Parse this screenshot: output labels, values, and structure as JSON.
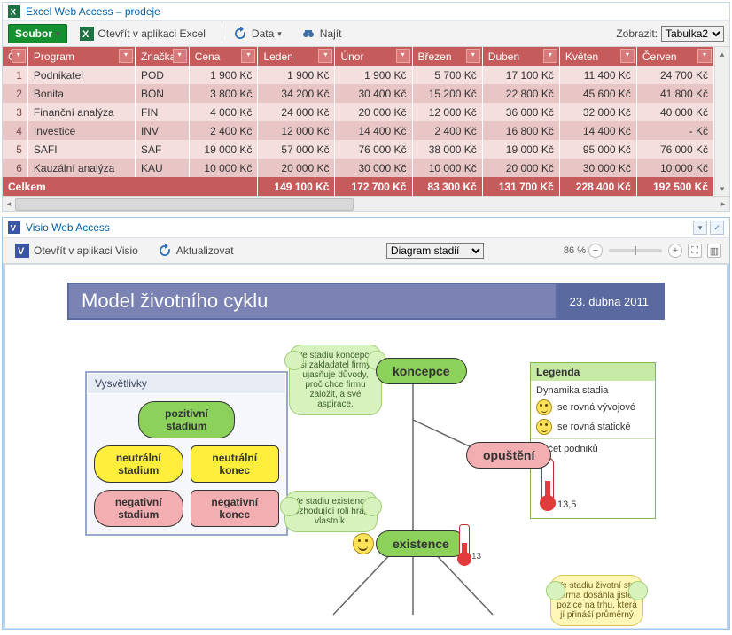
{
  "excel": {
    "title": "Excel Web Access – prodeje",
    "file_menu": "Soubor",
    "open_label": "Otevřít v aplikaci Excel",
    "data_label": "Data",
    "find_label": "Najít",
    "view_label": "Zobrazit:",
    "view_value": "Tabulka2",
    "columns": [
      "Č.",
      "Program",
      "Značka",
      "Cena",
      "Leden",
      "Únor",
      "Březen",
      "Duben",
      "Květen",
      "Červen"
    ],
    "rows": [
      {
        "n": "1",
        "prog": "Podnikatel",
        "zn": "POD",
        "cena": "1 900 Kč",
        "m": [
          "1 900 Kč",
          "1 900 Kč",
          "5 700 Kč",
          "17 100 Kč",
          "11 400 Kč",
          "24 700 Kč"
        ]
      },
      {
        "n": "2",
        "prog": "Bonita",
        "zn": "BON",
        "cena": "3 800 Kč",
        "m": [
          "34 200 Kč",
          "30 400 Kč",
          "15 200 Kč",
          "22 800 Kč",
          "45 600 Kč",
          "41 800 Kč"
        ]
      },
      {
        "n": "3",
        "prog": "Finanční analýza",
        "zn": "FIN",
        "cena": "4 000 Kč",
        "m": [
          "24 000 Kč",
          "20 000 Kč",
          "12 000 Kč",
          "36 000 Kč",
          "32 000 Kč",
          "40 000 Kč"
        ]
      },
      {
        "n": "4",
        "prog": "Investice",
        "zn": "INV",
        "cena": "2 400 Kč",
        "m": [
          "12 000 Kč",
          "14 400 Kč",
          "2 400 Kč",
          "16 800 Kč",
          "14 400 Kč",
          "-   Kč"
        ]
      },
      {
        "n": "5",
        "prog": "SAFI",
        "zn": "SAF",
        "cena": "19 000 Kč",
        "m": [
          "57 000 Kč",
          "76 000 Kč",
          "38 000 Kč",
          "19 000 Kč",
          "95 000 Kč",
          "76 000 Kč"
        ]
      },
      {
        "n": "6",
        "prog": "Kauzální analýza",
        "zn": "KAU",
        "cena": "10 000 Kč",
        "m": [
          "20 000 Kč",
          "30 000 Kč",
          "10 000 Kč",
          "20 000 Kč",
          "30 000 Kč",
          "10 000 Kč"
        ]
      }
    ],
    "total_label": "Celkem",
    "totals": [
      "149 100 Kč",
      "172 700 Kč",
      "83 300 Kč",
      "131 700 Kč",
      "228 400 Kč",
      "192 500 Kč"
    ]
  },
  "visio": {
    "title": "Visio Web Access",
    "open_label": "Otevřít v aplikaci Visio",
    "refresh_label": "Aktualizovat",
    "page_select": "Diagram stadií",
    "zoom": "86 %",
    "diagram_title": "Model životního cyklu",
    "diagram_date": "23. dubna 2011",
    "vys_title": "Vysvětlivky",
    "vys_items": [
      "pozitivní stadium",
      "neutrální stadium",
      "neutrální konec",
      "negativní stadium",
      "negativní konec"
    ],
    "legend_title": "Legenda",
    "legend_sub": "Dynamika stadia",
    "legend_r1": "se rovná vývojové",
    "legend_r2": "se rovná statické",
    "legend_count_label": "Počet podniků",
    "legend_count_value": "13,5",
    "node_koncepce": "koncepce",
    "node_opusteni": "opuštění",
    "node_existence": "existence",
    "therm_ex": "13",
    "cloud_koncepce": "Ve stadiu koncepce si zakladatel firmy ujasňuje důvody, proč chce firmu založit, a své aspirace.",
    "cloud_existence": "Ve stadiu existence rozhodující roli hraje vlastník.",
    "cloud_zivstyl": "Ve stadiu životní styl firma dosáhla jisté pozice na trhu, která jí přináší průměrný"
  },
  "chart_data": {
    "type": "table",
    "title": "Excel Web Access – prodeje",
    "columns": [
      "Č.",
      "Program",
      "Značka",
      "Cena",
      "Leden",
      "Únor",
      "Březen",
      "Duben",
      "Květen",
      "Červen"
    ],
    "rows": [
      [
        1,
        "Podnikatel",
        "POD",
        1900,
        1900,
        1900,
        5700,
        17100,
        11400,
        24700
      ],
      [
        2,
        "Bonita",
        "BON",
        3800,
        34200,
        30400,
        15200,
        22800,
        45600,
        41800
      ],
      [
        3,
        "Finanční analýza",
        "FIN",
        4000,
        24000,
        20000,
        12000,
        36000,
        32000,
        40000
      ],
      [
        4,
        "Investice",
        "INV",
        2400,
        12000,
        14400,
        2400,
        16800,
        14400,
        0
      ],
      [
        5,
        "SAFI",
        "SAF",
        19000,
        57000,
        76000,
        38000,
        19000,
        95000,
        76000
      ],
      [
        6,
        "Kauzální analýza",
        "KAU",
        10000,
        20000,
        30000,
        10000,
        20000,
        30000,
        10000
      ]
    ],
    "totals_row": [
      "Celkem",
      "",
      "",
      "",
      149100,
      172700,
      83300,
      131700,
      228400,
      192500
    ],
    "currency": "Kč"
  }
}
